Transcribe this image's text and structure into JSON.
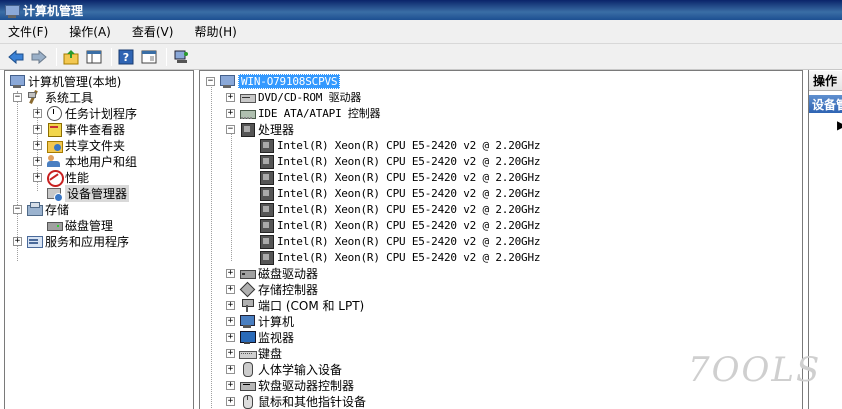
{
  "window": {
    "title": "计算机管理"
  },
  "menu": {
    "items": [
      "文件(F)",
      "操作(A)",
      "查看(V)",
      "帮助(H)"
    ]
  },
  "toolbar": {
    "buttons": [
      "back-arrow-icon",
      "forward-arrow-icon",
      "up-folder-icon",
      "show-hide-tree-icon",
      "help-icon",
      "properties-icon",
      "device-scan-icon"
    ]
  },
  "left_tree": {
    "root": "计算机管理(本地)",
    "system_tools": "系统工具",
    "task_scheduler": "任务计划程序",
    "event_viewer": "事件查看器",
    "shared_folders": "共享文件夹",
    "local_users": "本地用户和组",
    "performance": "性能",
    "device_manager": "设备管理器",
    "storage": "存储",
    "disk_management": "磁盘管理",
    "services_apps": "服务和应用程序"
  },
  "device_tree": {
    "root": "WIN-O79108SCPVS",
    "items": [
      "DVD/CD-ROM 驱动器",
      "IDE ATA/ATAPI 控制器",
      "处理器"
    ],
    "cpus": [
      "Intel(R) Xeon(R) CPU E5-2420 v2 @ 2.20GHz",
      "Intel(R) Xeon(R) CPU E5-2420 v2 @ 2.20GHz",
      "Intel(R) Xeon(R) CPU E5-2420 v2 @ 2.20GHz",
      "Intel(R) Xeon(R) CPU E5-2420 v2 @ 2.20GHz",
      "Intel(R) Xeon(R) CPU E5-2420 v2 @ 2.20GHz",
      "Intel(R) Xeon(R) CPU E5-2420 v2 @ 2.20GHz",
      "Intel(R) Xeon(R) CPU E5-2420 v2 @ 2.20GHz",
      "Intel(R) Xeon(R) CPU E5-2420 v2 @ 2.20GHz"
    ],
    "after": [
      "磁盘驱动器",
      "存储控制器",
      "端口 (COM 和 LPT)",
      "计算机",
      "监视器",
      "键盘",
      "人体学输入设备",
      "软盘驱动器控制器",
      "鼠标和其他指针设备"
    ]
  },
  "actions_pane": {
    "header": "操作",
    "section": "设备管理器"
  },
  "watermark": "7OOLS",
  "colors": {
    "selection": "#3399ff",
    "titlebar": "#0a246a",
    "panel_bg": "#f0f0f0"
  }
}
